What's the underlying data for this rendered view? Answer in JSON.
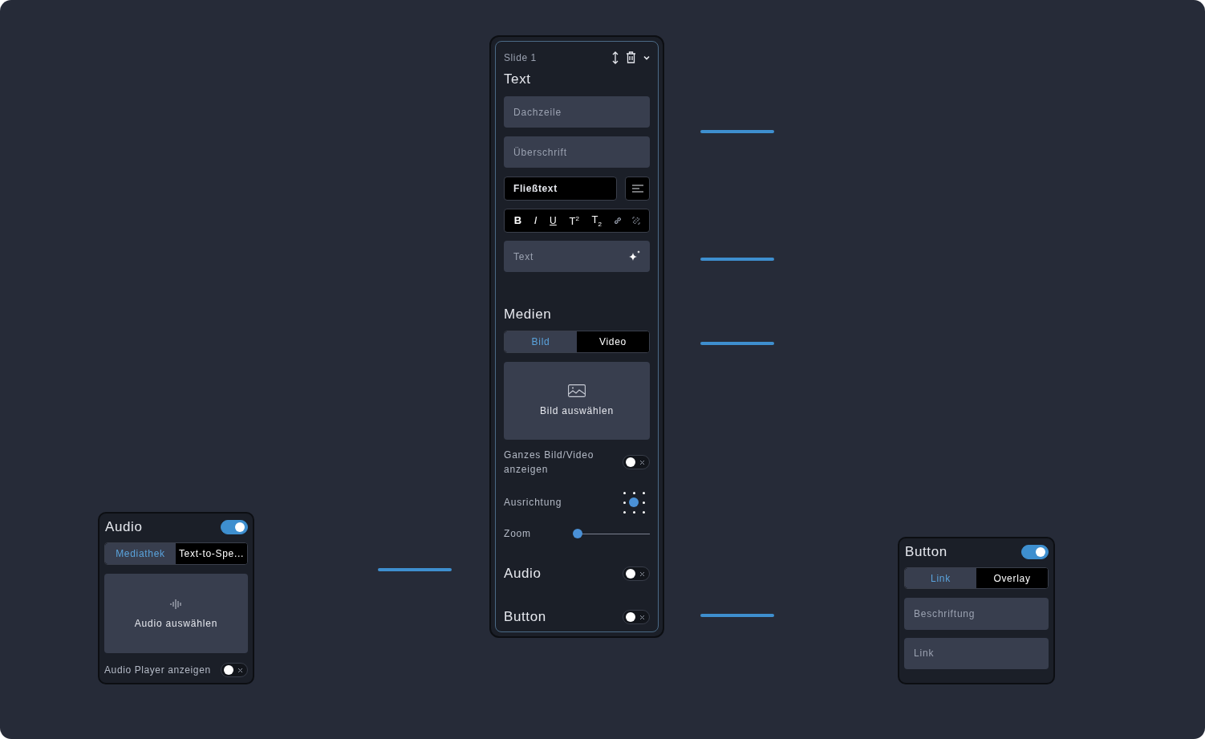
{
  "slide_panel": {
    "title": "Slide 1",
    "text_section": {
      "heading": "Text",
      "fields": [
        {
          "placeholder": "Dachzeile"
        },
        {
          "placeholder": "Überschrift"
        }
      ],
      "style_select": {
        "value": "Fließtext"
      },
      "format_buttons": [
        {
          "kind": "text",
          "label": "B"
        },
        {
          "kind": "text",
          "label": "I"
        },
        {
          "kind": "text",
          "label": "U"
        },
        {
          "kind": "text",
          "label": "T$^{2}$"
        },
        {
          "kind": "text",
          "label": "T$_{2}$"
        },
        {
          "kind": "link"
        },
        {
          "kind": "unlink"
        }
      ],
      "body_field": {
        "placeholder": "Text"
      }
    },
    "media_section": {
      "heading": "Medien",
      "tabs": [
        {
          "label": "Bild",
          "selected": true
        },
        {
          "label": "Video",
          "selected": false
        }
      ],
      "picker": {
        "label": "Bild auswählen"
      },
      "show_full": {
        "label": "Ganzes Bild/Video anzeigen",
        "on": false
      },
      "alignment": {
        "label": "Ausrichtung",
        "points": [
          {
            "selected": false
          },
          {
            "selected": false
          },
          {
            "selected": false
          },
          {
            "selected": false
          },
          {
            "selected": true
          },
          {
            "selected": false
          },
          {
            "selected": false
          },
          {
            "selected": false
          },
          {
            "selected": false
          }
        ]
      },
      "zoom": {
        "label": "Zoom",
        "level": 0
      }
    },
    "sections": [
      {
        "heading": "Audio",
        "on": false
      },
      {
        "heading": "Button",
        "on": false
      }
    ]
  },
  "audio_panel": {
    "title": "Audio",
    "on": true,
    "tabs": [
      {
        "label": "Mediathek",
        "selected": true
      },
      {
        "label": "Text-to-Spe...",
        "selected": false
      }
    ],
    "picker": {
      "label": "Audio auswählen"
    },
    "player_toggle": {
      "label": "Audio Player anzeigen",
      "on": false
    }
  },
  "button_panel": {
    "title": "Button",
    "on": true,
    "tabs": [
      {
        "label": "Link",
        "selected": true
      },
      {
        "label": "Overlay",
        "selected": false
      }
    ],
    "fields": [
      {
        "placeholder": "Beschriftung"
      },
      {
        "placeholder": "Link"
      }
    ]
  }
}
